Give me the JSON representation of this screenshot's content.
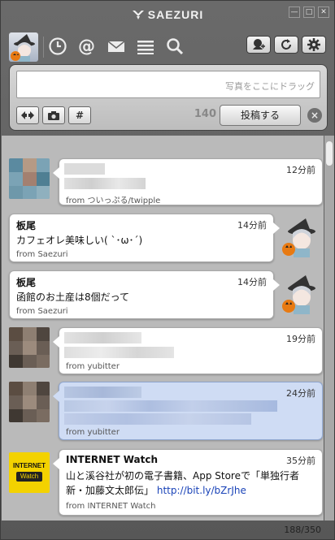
{
  "app": {
    "title": "SAEZURI"
  },
  "window_buttons": [
    "—",
    "□",
    "✕"
  ],
  "compose": {
    "placeholder": "写真をここにドラッグ",
    "char_count": "140",
    "post_label": "投稿する",
    "tag_label": "#"
  },
  "tweets": [
    {
      "name": "",
      "time": "12分前",
      "text": "",
      "source": "from ついっぷる/twipple"
    },
    {
      "name": "板尾",
      "time": "14分前",
      "text": "カフェオレ美味しい( `･ω･´)",
      "source": "from Saezuri"
    },
    {
      "name": "板尾",
      "time": "14分前",
      "text": "函館のお土産は8個だって",
      "source": "from Saezuri"
    },
    {
      "name": "",
      "time": "19分前",
      "text": "",
      "source": "from yubitter"
    },
    {
      "name": "",
      "time": "24分前",
      "text": "",
      "source": "from yubitter"
    },
    {
      "name": "INTERNET Watch",
      "time": "35分前",
      "text_line1": "山と溪谷社が初の電子書籍、App Storeで「単独行者",
      "text_line2": "新・加藤文太郎伝」",
      "link": "http://bit.ly/bZrJhe",
      "source": "from INTERNET Watch",
      "logo_top": "INTERNET",
      "logo_bottom": "Watch"
    }
  ],
  "status": {
    "count": "188/350"
  },
  "colors": {
    "selected_bubble": "#cfdcf4",
    "link": "#1a43b8",
    "logo_yellow": "#f3d200"
  }
}
